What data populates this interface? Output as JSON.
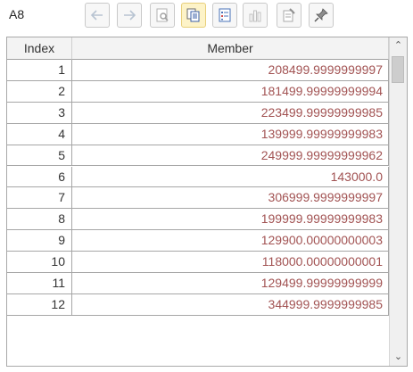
{
  "toolbar": {
    "cell_ref": "A8",
    "buttons": [
      {
        "name": "back-icon"
      },
      {
        "name": "forward-icon"
      },
      {
        "name": "preview-icon"
      },
      {
        "name": "copy-icon",
        "active": true
      },
      {
        "name": "list-view-icon"
      },
      {
        "name": "chart-icon"
      },
      {
        "name": "properties-icon"
      },
      {
        "name": "pin-icon"
      }
    ]
  },
  "table": {
    "columns": [
      "Index",
      "Member"
    ],
    "rows": [
      {
        "index": "1",
        "member": "208499.9999999997"
      },
      {
        "index": "2",
        "member": "181499.99999999994"
      },
      {
        "index": "3",
        "member": "223499.99999999985"
      },
      {
        "index": "4",
        "member": "139999.99999999983"
      },
      {
        "index": "5",
        "member": "249999.99999999962"
      },
      {
        "index": "6",
        "member": "143000.0"
      },
      {
        "index": "7",
        "member": "306999.9999999997"
      },
      {
        "index": "8",
        "member": "199999.99999999983"
      },
      {
        "index": "9",
        "member": "129900.00000000003"
      },
      {
        "index": "10",
        "member": "118000.00000000001"
      },
      {
        "index": "11",
        "member": "129499.99999999999"
      },
      {
        "index": "12",
        "member": "344999.9999999985"
      }
    ]
  },
  "colors": {
    "member_text": "#a25353",
    "header_bg": "#f3f3f3",
    "active_button_bg": "#fdf3c8"
  }
}
